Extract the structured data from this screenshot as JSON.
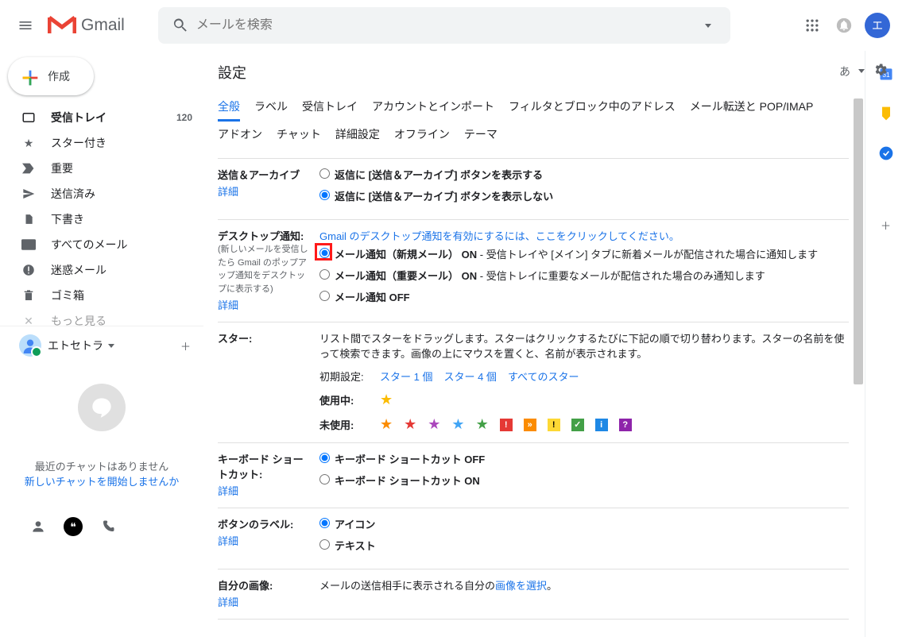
{
  "header": {
    "product": "Gmail",
    "search_placeholder": "メールを検索",
    "avatar_initial": "エ",
    "lang_indicator": "あ"
  },
  "compose_label": "作成",
  "nav": {
    "inbox": "受信トレイ",
    "inbox_count": "120",
    "starred": "スター付き",
    "important": "重要",
    "sent": "送信済み",
    "drafts": "下書き",
    "allmail": "すべてのメール",
    "spam": "迷惑メール",
    "trash": "ゴミ箱",
    "more": "もっと見る"
  },
  "hangouts": {
    "user": "エトセトラ",
    "empty1": "最近のチャットはありません",
    "empty2": "新しいチャットを開始しませんか"
  },
  "settings": {
    "title": "設定",
    "tabs": {
      "general": "全般",
      "labels": "ラベル",
      "inbox": "受信トレイ",
      "accounts": "アカウントとインポート",
      "filters": "フィルタとブロック中のアドレス",
      "forwarding": "メール転送と POP/IMAP",
      "addons": "アドオン",
      "chat": "チャット",
      "advanced": "詳細設定",
      "offline": "オフライン",
      "themes": "テーマ"
    },
    "details": "詳細",
    "send_archive": {
      "label": "送信＆アーカイブ",
      "opt1": "返信に [送信＆アーカイブ] ボタンを表示する",
      "opt2": "返信に [送信＆アーカイブ] ボタンを表示しない"
    },
    "desktop": {
      "label": "デスクトップ通知:",
      "sub": "(新しいメールを受信したら Gmail のポップアップ通知をデスクトップに表示する)",
      "enable_link": "Gmail のデスクトップ通知を有効にするには、ここをクリックしてください。",
      "opt1a": "メール通知（新規メール）",
      "opt1b": "ON",
      "opt1c": " - 受信トレイや [メイン] タブに新着メールが配信された場合に通知します",
      "opt2a": "メール通知（重要メール）",
      "opt2b": "ON",
      "opt2c": " - 受信トレイに重要なメールが配信された場合のみ通知します",
      "opt3": "メール通知 OFF"
    },
    "stars": {
      "label": "スター:",
      "desc": "リスト間でスターをドラッグします。スターはクリックするたびに下記の順で切り替わります。スターの名前を使って検索できます。画像の上にマウスを置くと、名前が表示されます。",
      "presets_label": "初期設定:",
      "preset1": "スター 1 個",
      "preset2": "スター 4 個",
      "preset3": "すべてのスター",
      "inuse": "使用中:",
      "notused": "未使用:"
    },
    "shortcuts": {
      "label": "キーボード ショートカット:",
      "opt1": "キーボード ショートカット OFF",
      "opt2": "キーボード ショートカット ON"
    },
    "button_labels": {
      "label": "ボタンのラベル:",
      "opt1": "アイコン",
      "opt2": "テキスト"
    },
    "picture": {
      "label": "自分の画像:",
      "desc_a": "メールの送信相手に表示される自分の",
      "desc_b": "画像を選択",
      "desc_c": "。"
    }
  }
}
